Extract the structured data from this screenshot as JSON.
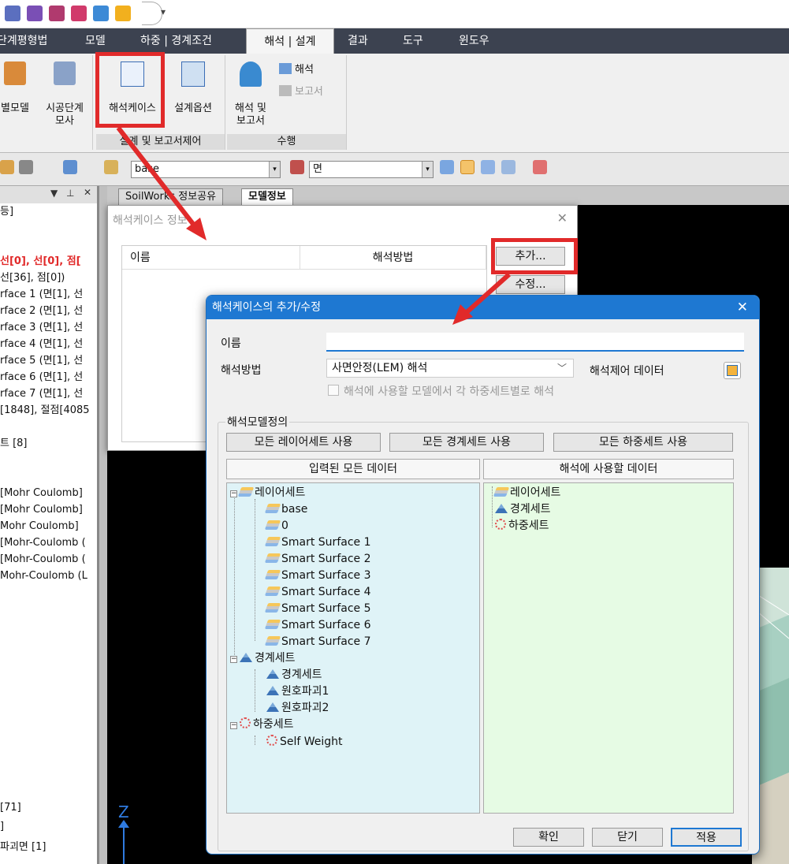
{
  "menubar": {
    "items": [
      "단계평형법",
      "모델",
      "하중 | 경계조건",
      "해석 | 설계",
      "결과",
      "도구",
      "윈도우"
    ]
  },
  "ribbon": {
    "btn_model": "별모델",
    "btn_stage1": "시공단계",
    "btn_stage2": "모사",
    "btn_case": "해석케이스",
    "btn_option": "설계옵션",
    "btn_run1": "해석 및",
    "btn_run2": "보고서",
    "btn_analysis": "해석",
    "btn_report": "보고서",
    "group_design": "설계 및 보고서제어",
    "group_run": "수행"
  },
  "toolbar": {
    "layer_combo": "base",
    "face_combo": "면"
  },
  "left_panel": {
    "lines": [
      "등]",
      "",
      "",
      "선[0], 선[0], 점[",
      "선[36], 점[0])",
      "rface 1 (면[1], 선",
      "rface 2 (면[1], 선",
      "rface 3 (면[1], 선",
      "rface 4 (면[1], 선",
      "rface 5 (면[1], 선",
      "rface 6 (면[1], 선",
      "rface 7 (면[1], 선",
      "[1848], 절점[4085",
      "",
      "트 [8]",
      "",
      "",
      "[Mohr Coulomb]",
      "[Mohr Coulomb]",
      "Mohr Coulomb]",
      "[Mohr-Coulomb (",
      "[Mohr-Coulomb (",
      "Mohr-Coulomb (L"
    ],
    "bottom": [
      "[71]",
      "]",
      "파괴면 [1]"
    ]
  },
  "tabs": {
    "tab1": "SoilWorks 정보공유",
    "tab2": "모델정보"
  },
  "dialog_cases": {
    "title": "해석케이스 정보",
    "col_name": "이름",
    "col_method": "해석방법",
    "add": "추가...",
    "edit": "수정..."
  },
  "dialog_add": {
    "title": "해석케이스의 추가/수정",
    "name_label": "이름",
    "name_value": "",
    "method_label": "해석방법",
    "method_value": "사면안정(LEM) 해석",
    "control_label": "해석제어 데이터",
    "checkbox_label": "해석에 사용할 모델에서 각 하중세트별로 해석",
    "group_label": "해석모델정의",
    "btn_all_layers": "모든 레이어세트 사용",
    "btn_all_bounds": "모든 경계세트 사용",
    "btn_all_loads": "모든 하중세트 사용",
    "left_header": "입력된 모든 데이터",
    "right_header": "해석에 사용할 데이터",
    "left_tree": {
      "layer_root": "레이어세트",
      "layers": [
        "base",
        "0",
        "Smart Surface 1",
        "Smart Surface 2",
        "Smart Surface 3",
        "Smart Surface 4",
        "Smart Surface 5",
        "Smart Surface 6",
        "Smart Surface 7"
      ],
      "bound_root": "경계세트",
      "bounds": [
        "경계세트",
        "원호파괴1",
        "원호파괴2"
      ],
      "load_root": "하중세트",
      "loads": [
        "Self Weight"
      ]
    },
    "right_tree": [
      "레이어세트",
      "경계세트",
      "하중세트"
    ],
    "ok": "확인",
    "close": "닫기",
    "apply": "적용"
  },
  "axis": {
    "z": "Z"
  },
  "colors": {
    "highlight": "#e12a2a",
    "accent": "#1e78d2"
  }
}
